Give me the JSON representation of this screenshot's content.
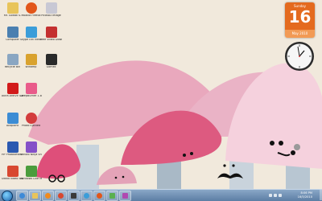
{
  "desktop_icons": [
    {
      "label": "Mr. Goltak S.",
      "color": "#e8c45a",
      "icon": "user-folder-icon"
    },
    {
      "label": "Mozilla Firefox",
      "color": "#e2561a",
      "icon": "firefox-icon"
    },
    {
      "label": "Picasa3 Image",
      "color": "#c8c8d4",
      "icon": "picasa-icon"
    },
    {
      "label": "Computer",
      "color": "#4a7fb0",
      "icon": "computer-icon"
    },
    {
      "label": "Skype Ext Viewer",
      "color": "#3b9dd9",
      "icon": "skype-icon"
    },
    {
      "label": "Free Video Downloader",
      "color": "#c43030",
      "icon": "downloader-icon"
    },
    {
      "label": "Recycle Bin",
      "color": "#8aa6c2",
      "icon": "recycle-bin-icon"
    },
    {
      "label": "Winamp",
      "color": "#d9a22e",
      "icon": "winamp-icon"
    },
    {
      "label": "Gomez",
      "color": "#2a2a2a",
      "icon": "media-player-icon"
    },
    {
      "label": "Avira AntiVir Control Ce...",
      "color": "#d21a1a",
      "icon": "avira-icon"
    },
    {
      "label": "DeepBurner 1.8",
      "color": "#e95b8a",
      "icon": "burner-icon"
    },
    {
      "label": "Allopoint",
      "color": "#3c8cd4",
      "icon": "app-icon"
    },
    {
      "label": "Photo Ejected",
      "color": "#d33c3c",
      "icon": "photo-icon"
    },
    {
      "label": "HP Photosmart Vid...",
      "color": "#2a58b0",
      "icon": "hp-icon"
    },
    {
      "label": "Naruto Ninja Shippuden",
      "color": "#8450c8",
      "icon": "game-icon"
    },
    {
      "label": "Ulead Video Studio",
      "color": "#d84830",
      "icon": "video-icon"
    },
    {
      "label": "Windows Live Movie...",
      "color": "#4a9c3c",
      "icon": "movie-maker-icon"
    }
  ],
  "calendar": {
    "weekday": "Sunday",
    "day": "16",
    "month_year": "May 2010"
  },
  "taskbar": {
    "apps": [
      {
        "icon": "ie-icon",
        "color": "#3d8ad8"
      },
      {
        "icon": "explorer-icon",
        "color": "#e8c45a"
      },
      {
        "icon": "media-player-icon",
        "color": "#f08a1e"
      },
      {
        "icon": "chrome-icon",
        "color": "#d84830"
      },
      {
        "icon": "winamp-icon",
        "color": "#3a3a3a"
      },
      {
        "icon": "skype-icon",
        "color": "#3b9dd9"
      },
      {
        "icon": "firefox-icon",
        "color": "#e2561a"
      },
      {
        "icon": "msn-icon",
        "color": "#5ab050"
      },
      {
        "icon": "paint-icon",
        "color": "#b04ab0"
      }
    ],
    "time": "8:06 PM",
    "date": "16/5/2010"
  }
}
